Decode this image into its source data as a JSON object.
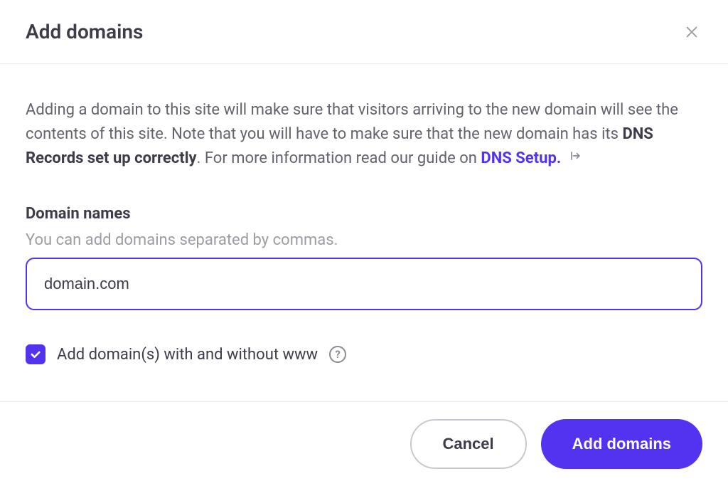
{
  "header": {
    "title": "Add domains"
  },
  "body": {
    "description_prefix": "Adding a domain to this site will make sure that visitors arriving to the new domain will see the contents of this site. Note that you will have to make sure that the new domain has its ",
    "description_bold": "DNS Records set up correctly",
    "description_mid": ". For more information read our guide on ",
    "description_link": "DNS Setup.",
    "field_label": "Domain names",
    "field_hint": "You can add domains separated by commas.",
    "input_value": "domain.com",
    "checkbox_checked": true,
    "checkbox_label": "Add domain(s) with and without www"
  },
  "footer": {
    "cancel_label": "Cancel",
    "submit_label": "Add domains"
  }
}
